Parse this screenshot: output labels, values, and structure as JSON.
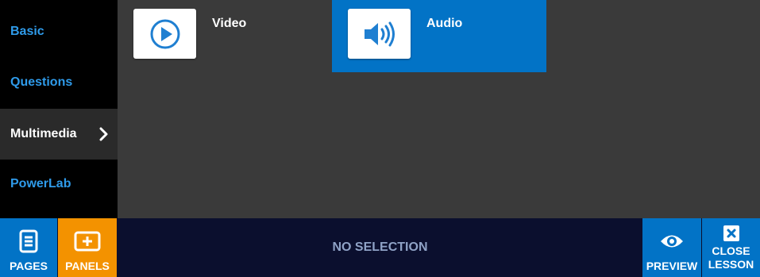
{
  "sidebar": {
    "items": [
      {
        "label": "Basic"
      },
      {
        "label": "Questions"
      },
      {
        "label": "Multimedia"
      },
      {
        "label": "PowerLab"
      }
    ]
  },
  "main": {
    "tiles": [
      {
        "label": "Video",
        "icon": "play-circle-icon"
      },
      {
        "label": "Audio",
        "icon": "speaker-icon"
      }
    ]
  },
  "toolbar": {
    "pages_label": "PAGES",
    "panels_label": "PANELS",
    "status_text": "NO SELECTION",
    "preview_label": "PREVIEW",
    "close_label_line1": "CLOSE",
    "close_label_line2": "LESSON"
  },
  "colors": {
    "accent_blue": "#0273c6",
    "panels_orange": "#f39200",
    "sidebar_link": "#2f9bea",
    "toolbar_bg": "#0b0f2e"
  }
}
